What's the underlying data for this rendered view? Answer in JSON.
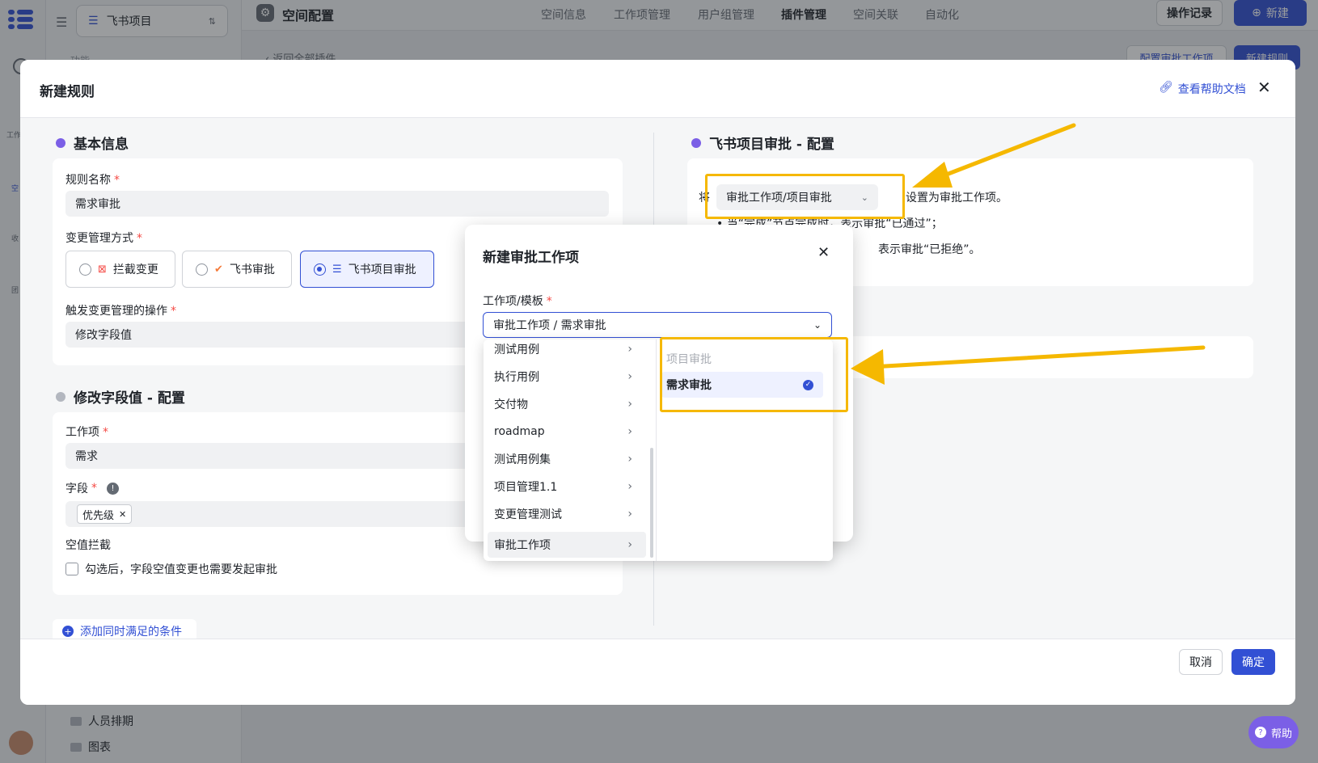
{
  "app": {
    "project_select": "飞书项目",
    "sidebar_hint": "功能",
    "sidebar_items": [
      "人员排期",
      "图表"
    ],
    "rail_labels": [
      "工作",
      "空",
      "收",
      "团"
    ]
  },
  "header": {
    "title": "空间配置",
    "tabs": [
      "空间信息",
      "工作项管理",
      "用户组管理",
      "插件管理",
      "空间关联",
      "自动化"
    ],
    "active_tab_index": 3,
    "history_button": "操作记录",
    "new_button": "新建"
  },
  "page": {
    "back_link": "返回全部插件",
    "config_button": "配置审批工作项",
    "new_rule_button": "新建规则",
    "help_float": "帮助"
  },
  "modal": {
    "title": "新建规则",
    "help_link": "查看帮助文档",
    "basic_info": {
      "title": "基本信息",
      "rule_name_label": "规则名称",
      "rule_name_value": "需求审批",
      "change_mode_label": "变更管理方式",
      "change_modes": [
        "拦截变更",
        "飞书审批",
        "飞书项目审批"
      ],
      "selected_mode_index": 2,
      "trigger_label": "触发变更管理的操作",
      "trigger_value": "修改字段值"
    },
    "field_config": {
      "title": "修改字段值 - 配置",
      "workitem_label": "工作项",
      "workitem_value": "需求",
      "field_label": "字段",
      "field_tag": "优先级",
      "empty_intercept_label": "空值拦截",
      "empty_intercept_text": "勾选后，字段空值变更也需要发起审批"
    },
    "add_condition": "添加同时满足的条件",
    "approval_config": {
      "title": "飞书项目审批 - 配置",
      "prefix": "将",
      "select_value": "审批工作项/项目审批",
      "suffix": "设置为审批工作项。",
      "bullet1": "当“完成”节点完成时，表示审批“已通过”；",
      "bullet2": "表示审批“已拒绝”。"
    },
    "cancel": "取消",
    "confirm": "确定"
  },
  "dialog": {
    "title": "新建审批工作项",
    "field_label": "工作项/模板",
    "field_value": "审批工作项 / 需求审批",
    "left_options": [
      "测试用例",
      "执行用例",
      "交付物",
      "roadmap",
      "测试用例集",
      "项目管理1.1",
      "变更管理测试",
      "审批工作项"
    ],
    "hover_index": 7,
    "right_options": [
      "项目审批",
      "需求审批"
    ],
    "selected_right_index": 1
  },
  "colors": {
    "primary": "#3250d4",
    "accent_purple": "#7b5fe6",
    "highlight": "#f5b800",
    "required": "#f54a45"
  }
}
